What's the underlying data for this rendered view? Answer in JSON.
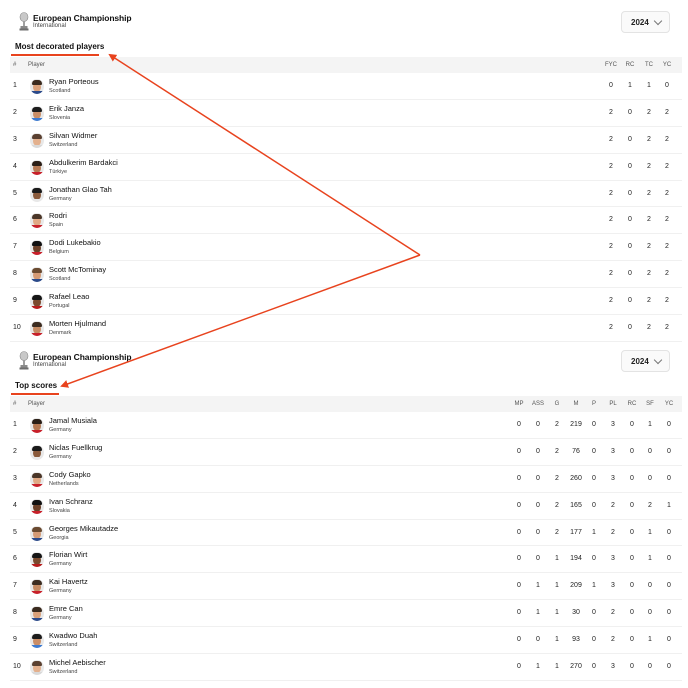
{
  "sections": [
    {
      "competition": {
        "name": "European Championship",
        "subtitle": "International",
        "year": "2024"
      },
      "title": "Most decorated players",
      "columns": {
        "rank": "#",
        "player": "Player",
        "stats": [
          "FYC",
          "RC",
          "TC",
          "YC"
        ]
      },
      "rows": [
        {
          "rank": "1",
          "name": "Ryan Porteous",
          "country": "Scotland",
          "stats": [
            "0",
            "1",
            "1",
            "0"
          ]
        },
        {
          "rank": "2",
          "name": "Erik Janza",
          "country": "Slovenia",
          "stats": [
            "2",
            "0",
            "2",
            "2"
          ]
        },
        {
          "rank": "3",
          "name": "Silvan Widmer",
          "country": "Switzerland",
          "stats": [
            "2",
            "0",
            "2",
            "2"
          ]
        },
        {
          "rank": "4",
          "name": "Abdulkerim Bardakci",
          "country": "Türkiye",
          "stats": [
            "2",
            "0",
            "2",
            "2"
          ]
        },
        {
          "rank": "5",
          "name": "Jonathan Glao Tah",
          "country": "Germany",
          "stats": [
            "2",
            "0",
            "2",
            "2"
          ]
        },
        {
          "rank": "6",
          "name": "Rodri",
          "country": "Spain",
          "stats": [
            "2",
            "0",
            "2",
            "2"
          ]
        },
        {
          "rank": "7",
          "name": "Dodi Lukebakio",
          "country": "Belgium",
          "stats": [
            "2",
            "0",
            "2",
            "2"
          ]
        },
        {
          "rank": "8",
          "name": "Scott McTominay",
          "country": "Scotland",
          "stats": [
            "2",
            "0",
            "2",
            "2"
          ]
        },
        {
          "rank": "9",
          "name": "Rafael Leao",
          "country": "Portugal",
          "stats": [
            "2",
            "0",
            "2",
            "2"
          ]
        },
        {
          "rank": "10",
          "name": "Morten Hjulmand",
          "country": "Denmark",
          "stats": [
            "2",
            "0",
            "2",
            "2"
          ]
        }
      ]
    },
    {
      "competition": {
        "name": "European Championship",
        "subtitle": "International",
        "year": "2024"
      },
      "title": "Top scores",
      "columns": {
        "rank": "#",
        "player": "Player",
        "stats": [
          "MP",
          "ASS",
          "G",
          "M",
          "P",
          "PL",
          "RC",
          "SF",
          "YC"
        ]
      },
      "rows": [
        {
          "rank": "1",
          "name": "Jamal Musiala",
          "country": "Germany",
          "stats": [
            "0",
            "0",
            "2",
            "219",
            "0",
            "3",
            "0",
            "1",
            "0"
          ]
        },
        {
          "rank": "2",
          "name": "Niclas Fuellkrug",
          "country": "Germany",
          "stats": [
            "0",
            "0",
            "2",
            "76",
            "0",
            "3",
            "0",
            "0",
            "0"
          ]
        },
        {
          "rank": "3",
          "name": "Cody Gapko",
          "country": "Netherlands",
          "stats": [
            "0",
            "0",
            "2",
            "260",
            "0",
            "3",
            "0",
            "0",
            "0"
          ]
        },
        {
          "rank": "4",
          "name": "Ivan Schranz",
          "country": "Slovakia",
          "stats": [
            "0",
            "0",
            "2",
            "165",
            "0",
            "2",
            "0",
            "2",
            "1"
          ]
        },
        {
          "rank": "5",
          "name": "Georges Mikautadze",
          "country": "Georgia",
          "stats": [
            "0",
            "0",
            "2",
            "177",
            "1",
            "2",
            "0",
            "1",
            "0"
          ]
        },
        {
          "rank": "6",
          "name": "Florian Wirt",
          "country": "Germany",
          "stats": [
            "0",
            "0",
            "1",
            "194",
            "0",
            "3",
            "0",
            "1",
            "0"
          ]
        },
        {
          "rank": "7",
          "name": "Kai Havertz",
          "country": "Germany",
          "stats": [
            "0",
            "1",
            "1",
            "209",
            "1",
            "3",
            "0",
            "0",
            "0"
          ]
        },
        {
          "rank": "8",
          "name": "Emre Can",
          "country": "Germany",
          "stats": [
            "0",
            "1",
            "1",
            "30",
            "0",
            "2",
            "0",
            "0",
            "0"
          ]
        },
        {
          "rank": "9",
          "name": "Kwadwo Duah",
          "country": "Switzerland",
          "stats": [
            "0",
            "0",
            "1",
            "93",
            "0",
            "2",
            "0",
            "1",
            "0"
          ]
        },
        {
          "rank": "10",
          "name": "Michel Aebischer",
          "country": "Switzerland",
          "stats": [
            "0",
            "1",
            "1",
            "270",
            "0",
            "3",
            "0",
            "0",
            "0"
          ]
        }
      ]
    }
  ],
  "colors": {
    "accent": "#e8431e",
    "header_bg": "#f4f4f4",
    "divider": "#f0f0f0"
  },
  "icons": {
    "competition_logo": "trophy-icon",
    "year_dropdown": "chevron-down-icon"
  }
}
